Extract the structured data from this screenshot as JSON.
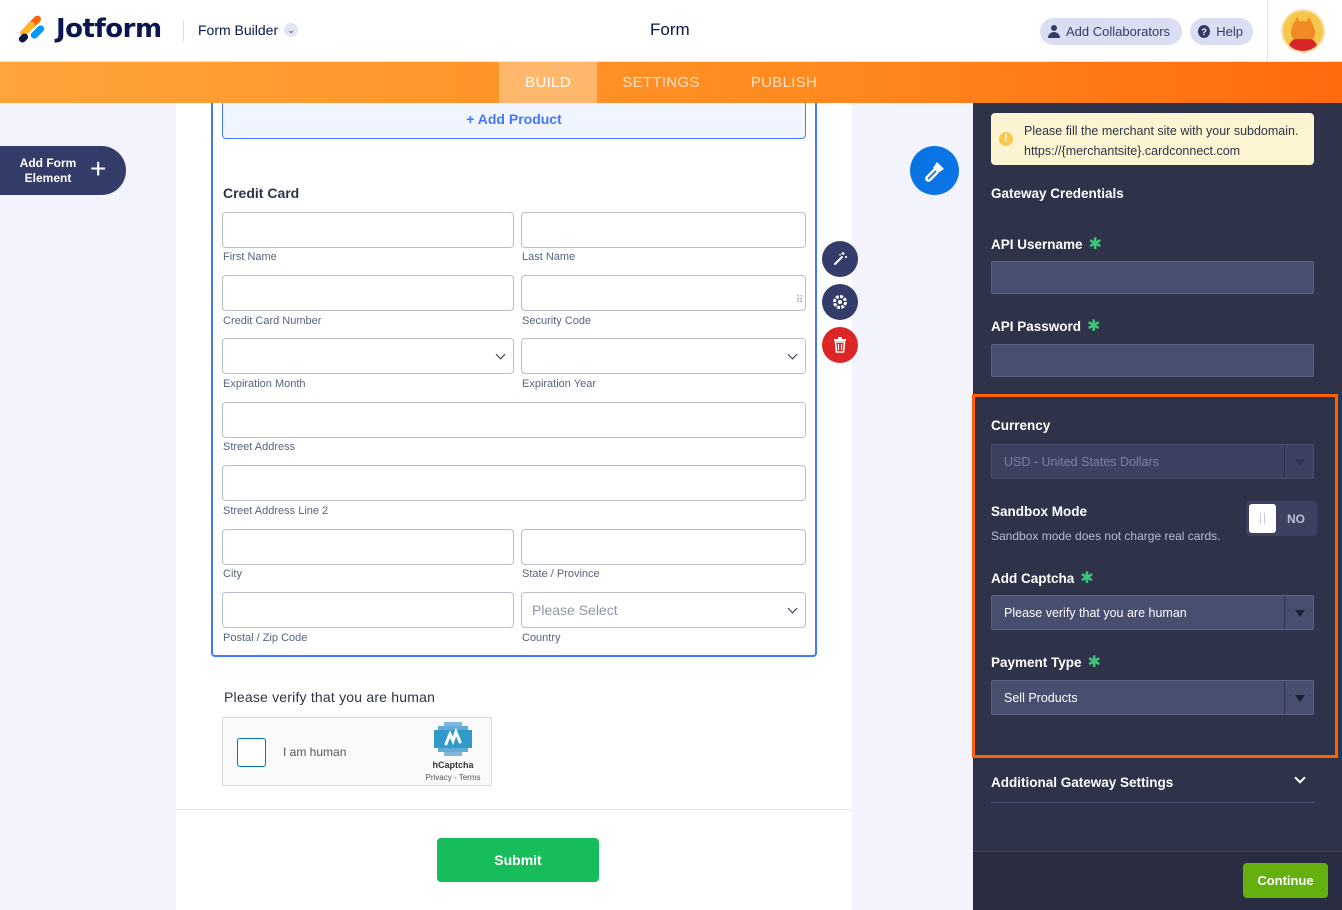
{
  "header": {
    "brand": "Jotform",
    "builder_label": "Form Builder",
    "page_title": "Form",
    "collaborators_label": "Add Collaborators",
    "help_label": "Help"
  },
  "nav": {
    "tabs": [
      {
        "label": "BUILD",
        "active": true
      },
      {
        "label": "SETTINGS",
        "active": false
      },
      {
        "label": "PUBLISH",
        "active": false
      }
    ]
  },
  "left": {
    "add_element_label": "Add Form Element"
  },
  "form": {
    "add_product_label": "+ Add Product",
    "credit_card_title": "Credit Card",
    "fields": {
      "first_name": "First Name",
      "last_name": "Last Name",
      "card_number": "Credit Card Number",
      "security_code": "Security Code",
      "exp_month": "Expiration Month",
      "exp_year": "Expiration Year",
      "street": "Street Address",
      "street2": "Street Address Line 2",
      "city": "City",
      "state": "State / Province",
      "postal": "Postal / Zip Code",
      "country": "Country"
    },
    "country_placeholder": "Please Select",
    "captcha_label": "Please verify that you are human",
    "captcha": {
      "checkbox_text": "I am human",
      "brand": "hCaptcha",
      "links": "Privacy - Terms"
    },
    "submit_label": "Submit"
  },
  "panel": {
    "notice": "Please fill the merchant site with your subdomain. https://{merchantsite}.cardconnect.com",
    "gateway_credentials": "Gateway Credentials",
    "api_username_label": "API Username",
    "api_password_label": "API Password",
    "currency_label": "Currency",
    "currency_value": "USD - United States Dollars",
    "sandbox_label": "Sandbox Mode",
    "sandbox_sub": "Sandbox mode does not charge real cards.",
    "sandbox_toggle": "NO",
    "captcha_label": "Add Captcha",
    "captcha_value": "Please verify that you are human",
    "payment_type_label": "Payment Type",
    "payment_type_value": "Sell Products",
    "additional_settings": "Additional Gateway Settings",
    "continue_label": "Continue"
  },
  "colors": {
    "accent_orange": "#ff6100",
    "primary_blue": "#4277ff",
    "submit_green": "#18bd5b",
    "continue_green": "#64b00f",
    "panel_bg": "#2f3349"
  }
}
